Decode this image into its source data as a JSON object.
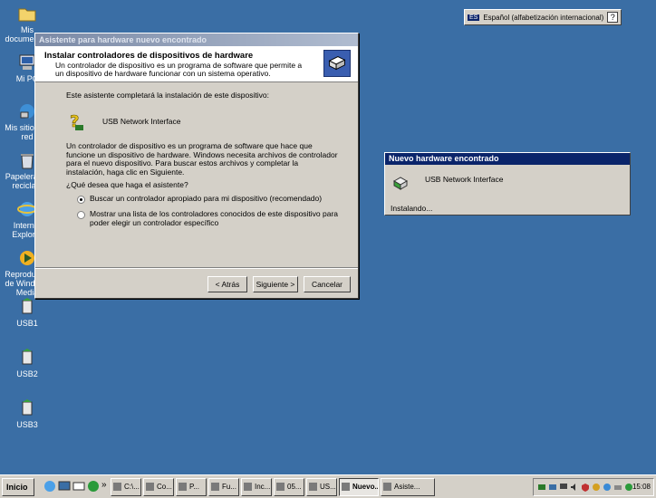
{
  "colors": {
    "desktop": "#3a6ea5",
    "titlebar_active": "#0a246a"
  },
  "desktop_icons": [
    {
      "label": "Mis documentos",
      "icon": "folder-icon"
    },
    {
      "label": "Mi PC",
      "icon": "computer-icon"
    },
    {
      "label": "Mis sitios de red",
      "icon": "network-icon"
    },
    {
      "label": "Papelera de reciclaje",
      "icon": "recycle-bin-icon"
    },
    {
      "label": "Internet Explorer",
      "icon": "internet-explorer-icon"
    },
    {
      "label": "Reproductor de Windows Media",
      "icon": "media-player-icon"
    },
    {
      "label": "USB1",
      "icon": "usb-icon"
    },
    {
      "label": "USB2",
      "icon": "usb-icon"
    },
    {
      "label": "USB3",
      "icon": "usb-icon"
    }
  ],
  "langbar": {
    "language": "Español (alfabetización internacional)",
    "code": "ES",
    "help": "?"
  },
  "wizard": {
    "title": "Asistente para hardware nuevo encontrado",
    "header_title": "Instalar controladores de dispositivos de hardware",
    "header_subtitle": "Un controlador de dispositivo es un programa de software que permite a un dispositivo de hardware funcionar con un sistema operativo.",
    "intro": "Este asistente completará la instalación de este dispositivo:",
    "device": "USB Network Interface",
    "description": "Un controlador de dispositivo es un programa de software que hace que funcione un dispositivo de hardware. Windows necesita archivos de controlador para el nuevo dispositivo. Para buscar estos archivos y completar la instalación, haga clic en Siguiente.",
    "question": "¿Qué desea que haga el asistente?",
    "options": [
      {
        "label": "Buscar un controlador apropiado para mi dispositivo (recomendado)",
        "checked": true
      },
      {
        "label": "Mostrar una lista de los controladores conocidos de este dispositivo para poder elegir un controlador específico",
        "checked": false
      }
    ],
    "buttons": {
      "back": "< Atrás",
      "next": "Siguiente >",
      "cancel": "Cancelar"
    }
  },
  "balloon": {
    "title": "Nuevo hardware encontrado",
    "device": "USB Network Interface",
    "status": "Instalando..."
  },
  "taskbar": {
    "start": "Inicio",
    "chevron": "»",
    "buttons": [
      "C:\\...",
      "Co...",
      "P...",
      "Fu...",
      "Inc...",
      "05...",
      "US...",
      "Nuevo...",
      "Asiste..."
    ],
    "active_index": 7,
    "clock": "15:08"
  }
}
